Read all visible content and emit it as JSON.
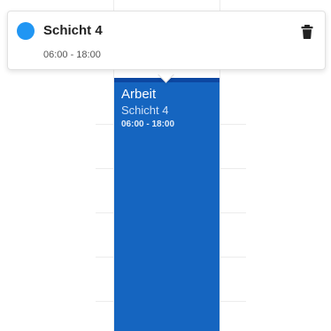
{
  "popover": {
    "title": "Schicht 4",
    "time": "06:00 - 18:00",
    "color": "#2196f3",
    "delete_icon": "trash-icon"
  },
  "event": {
    "title": "Arbeit",
    "subtitle": "Schicht 4",
    "time": "06:00 - 18:00",
    "color": "#1565c0"
  }
}
